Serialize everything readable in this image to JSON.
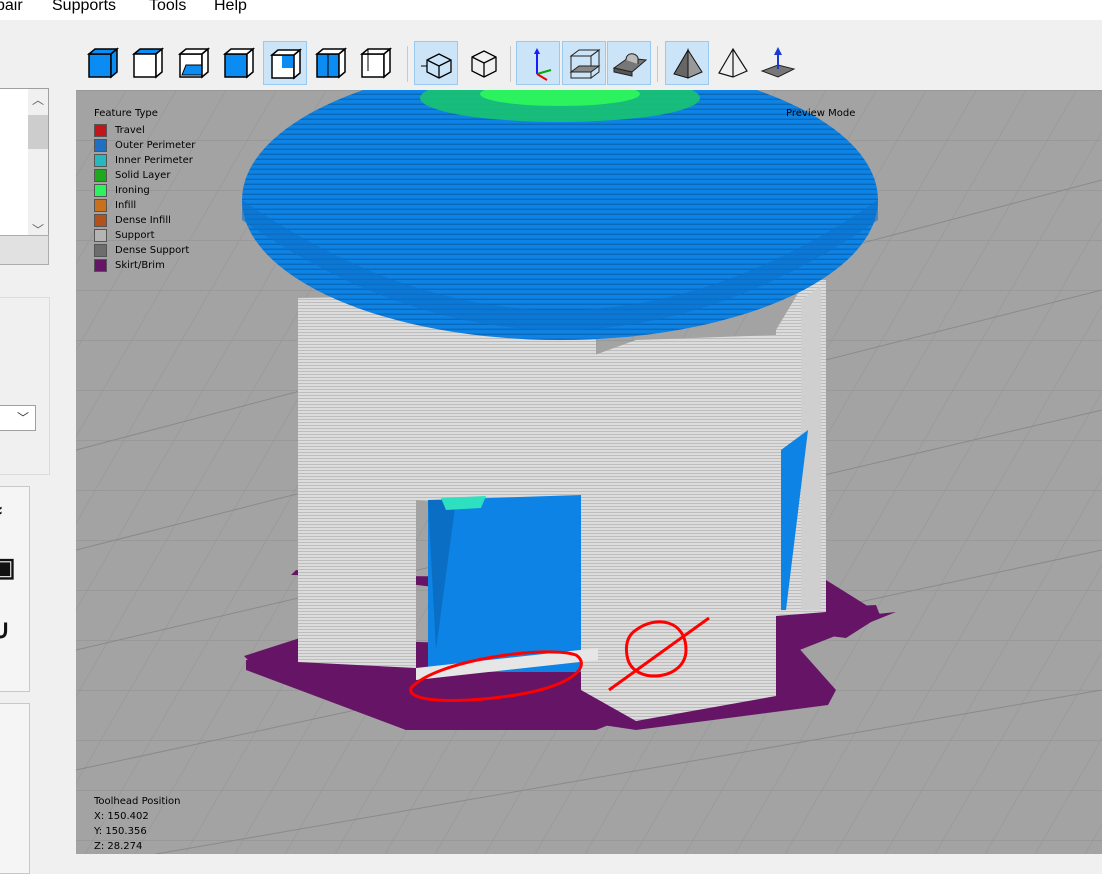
{
  "menu": {
    "items": [
      "pair",
      "Supports",
      "Tools",
      "Help"
    ]
  },
  "toolbar": {
    "view_buttons": [
      {
        "icon": "iso-cube-icon",
        "active": false
      },
      {
        "icon": "front-view-icon",
        "active": false
      },
      {
        "icon": "back-view-icon",
        "active": false
      },
      {
        "icon": "left-view-icon",
        "active": false
      },
      {
        "icon": "right-view-icon",
        "active": true
      },
      {
        "icon": "top-view-icon",
        "active": false
      },
      {
        "icon": "bottom-view-icon",
        "active": false
      }
    ],
    "projection_buttons": [
      {
        "icon": "perspective-icon",
        "active": true
      },
      {
        "icon": "orthographic-icon",
        "active": false
      }
    ],
    "display_buttons": [
      {
        "icon": "axes-icon",
        "active": true
      },
      {
        "icon": "build-volume-icon",
        "active": true
      },
      {
        "icon": "print-bed-icon",
        "active": true
      }
    ],
    "mode_buttons": [
      {
        "icon": "shaded-model-icon",
        "active": true
      },
      {
        "icon": "wireframe-model-icon",
        "active": false
      },
      {
        "icon": "surface-normal-icon",
        "active": false
      }
    ]
  },
  "viewport": {
    "legend_title": "Feature Type",
    "legend": [
      {
        "label": "Travel",
        "color": "#c0161c"
      },
      {
        "label": "Outer Perimeter",
        "color": "#1f6fc2"
      },
      {
        "label": "Inner Perimeter",
        "color": "#26b8bf"
      },
      {
        "label": "Solid Layer",
        "color": "#1ea81e"
      },
      {
        "label": "Ironing",
        "color": "#2cf25f"
      },
      {
        "label": "Infill",
        "color": "#c8701b"
      },
      {
        "label": "Dense Infill",
        "color": "#b2521a"
      },
      {
        "label": "Support",
        "color": "#b4b4b4"
      },
      {
        "label": "Dense Support",
        "color": "#6d6d6d"
      },
      {
        "label": "Skirt/Brim",
        "color": "#661566"
      }
    ],
    "mode_label": "Preview Mode",
    "toolhead": {
      "title": "Toolhead Position",
      "x": "X: 150.402",
      "y": "Y: 150.356",
      "z": "Z: 28.274"
    }
  }
}
